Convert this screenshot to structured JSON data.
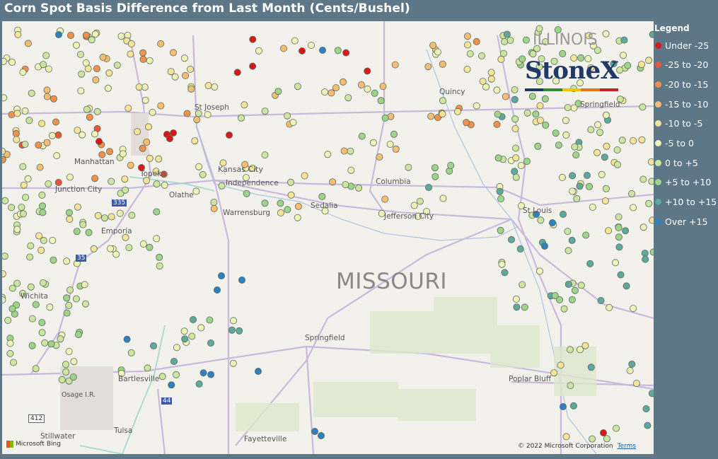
{
  "title": "Corn Spot Basis Difference from Last Month (Cents/Bushel)",
  "legend": {
    "title": "Legend",
    "items": [
      {
        "label": "Under -25",
        "color": "#d7191c"
      },
      {
        "label": "-25 to -20",
        "color": "#e8553a"
      },
      {
        "label": "-20 to -15",
        "color": "#f0904e"
      },
      {
        "label": "-15 to -10",
        "color": "#f6bd73"
      },
      {
        "label": "-10 to -5",
        "color": "#f7e39a"
      },
      {
        "label": "-5 to 0",
        "color": "#eef3b8"
      },
      {
        "label": "0 to +5",
        "color": "#cde5a0"
      },
      {
        "label": "+5 to +10",
        "color": "#9ed38a"
      },
      {
        "label": "+10 to +15",
        "color": "#5fa89d"
      },
      {
        "label": "Over +15",
        "color": "#2f7fc1"
      }
    ]
  },
  "map": {
    "state_label": "MISSOURI",
    "places": [
      "St Joseph",
      "Kansas City",
      "Independence",
      "Manhattan",
      "Topeka",
      "Junction City",
      "Olathe",
      "Emporia",
      "Warrensburg",
      "Sedalia",
      "Columbia",
      "Jefferson City",
      "Springfield",
      "Wichita",
      "Bartlesville",
      "Osage I.R.",
      "Tulsa",
      "Stillwater",
      "Fayetteville",
      "Poplar Bluff",
      "St Louis",
      "Springfield",
      "Quincy",
      "ILLINOIS"
    ],
    "highway_shields": [
      "335",
      "35",
      "44",
      "412"
    ]
  },
  "logo": {
    "text": "StoneX"
  },
  "attribution": {
    "bing": "Microsoft Bing",
    "copyright": "© 2022 Microsoft Corporation",
    "terms": "Terms"
  }
}
